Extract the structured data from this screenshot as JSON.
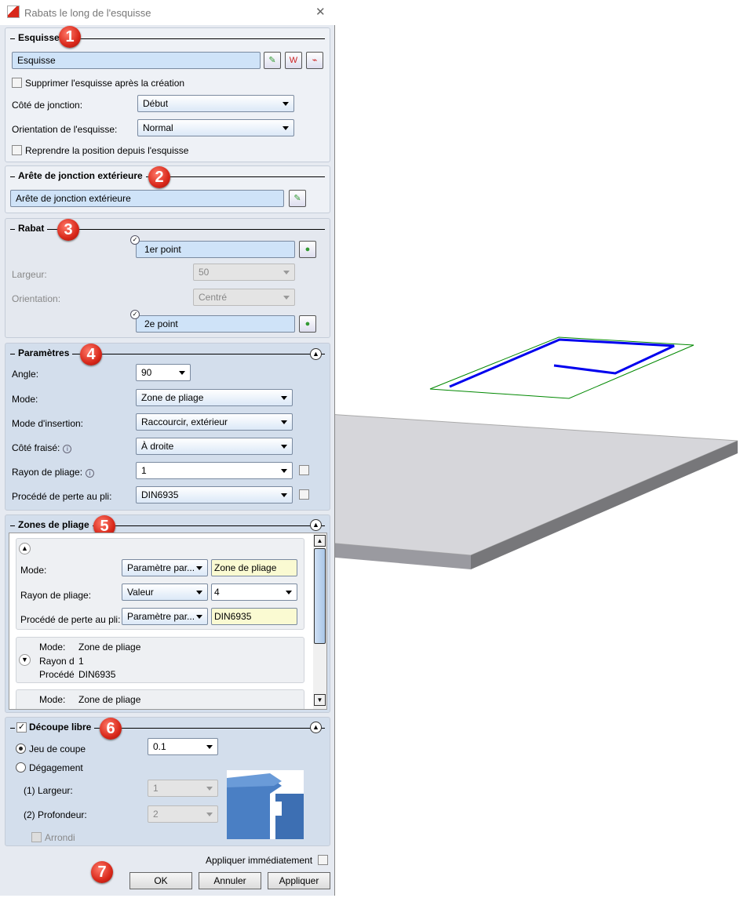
{
  "window": {
    "title": "Rabats le long de l'esquisse",
    "close": "✕"
  },
  "sections": {
    "esquisse": {
      "title": "Esquisse",
      "badge": "1",
      "field": "Esquisse",
      "delete_sketch": "Supprimer l'esquisse après la création",
      "side_label": "Côté de jonction:",
      "side_value": "Début",
      "orient_label": "Orientation de l'esquisse:",
      "orient_value": "Normal",
      "take_position": "Reprendre la position depuis l'esquisse"
    },
    "arete": {
      "title": "Arête de jonction extérieure",
      "badge": "2",
      "field": "Arête de jonction extérieure"
    },
    "rabat": {
      "title": "Rabat",
      "badge": "3",
      "point1": "1er point",
      "width_label": "Largeur:",
      "width_value": "50",
      "orient_label": "Orientation:",
      "orient_value": "Centré",
      "point2": "2e point"
    },
    "parametres": {
      "title": "Paramètres",
      "badge": "4",
      "angle_label": "Angle:",
      "angle_value": "90",
      "mode_label": "Mode:",
      "mode_value": "Zone de pliage",
      "insert_label": "Mode d'insertion:",
      "insert_value": "Raccourcir, extérieur",
      "milled_label": "Côté fraisé:",
      "milled_value": "À droite",
      "radius_label": "Rayon de pliage:",
      "radius_value": "1",
      "loss_label": "Procédé de perte au pli:",
      "loss_value": "DIN6935"
    },
    "zones": {
      "title": "Zones de pliage",
      "badge": "5",
      "expanded": {
        "mode_label": "Mode:",
        "mode_combo": "Paramètre par...",
        "mode_value": "Zone de pliage",
        "radius_label": "Rayon de pliage:",
        "radius_combo": "Valeur",
        "radius_value": "4",
        "loss_label": "Procédé de perte au pli:",
        "loss_combo": "Paramètre par...",
        "loss_value": "DIN6935"
      },
      "collapsed": [
        {
          "mode_label": "Mode:",
          "mode": "Zone de pliage",
          "radius_label": "Rayon d",
          "radius": "1",
          "loss_label": "Procédé",
          "loss": "DIN6935"
        },
        {
          "mode_label": "Mode:",
          "mode": "Zone de pliage"
        }
      ]
    },
    "decoupe": {
      "title": "Découpe libre",
      "badge": "6",
      "jeu_label": "Jeu de coupe",
      "jeu_value": "0.1",
      "degagement_label": "Dégagement",
      "largeur_label": "(1) Largeur:",
      "largeur_value": "1",
      "profondeur_label": "(2) Profondeur:",
      "profondeur_value": "2",
      "arrondi_label": "Arrondi"
    }
  },
  "footer": {
    "badge": "7",
    "apply_now": "Appliquer immédiatement",
    "ok": "OK",
    "cancel": "Annuler",
    "apply": "Appliquer"
  },
  "colors": {
    "badge": "#d8281a",
    "sketch": "#0000ee",
    "plane": "#008800",
    "plate": "#d6d6da"
  }
}
